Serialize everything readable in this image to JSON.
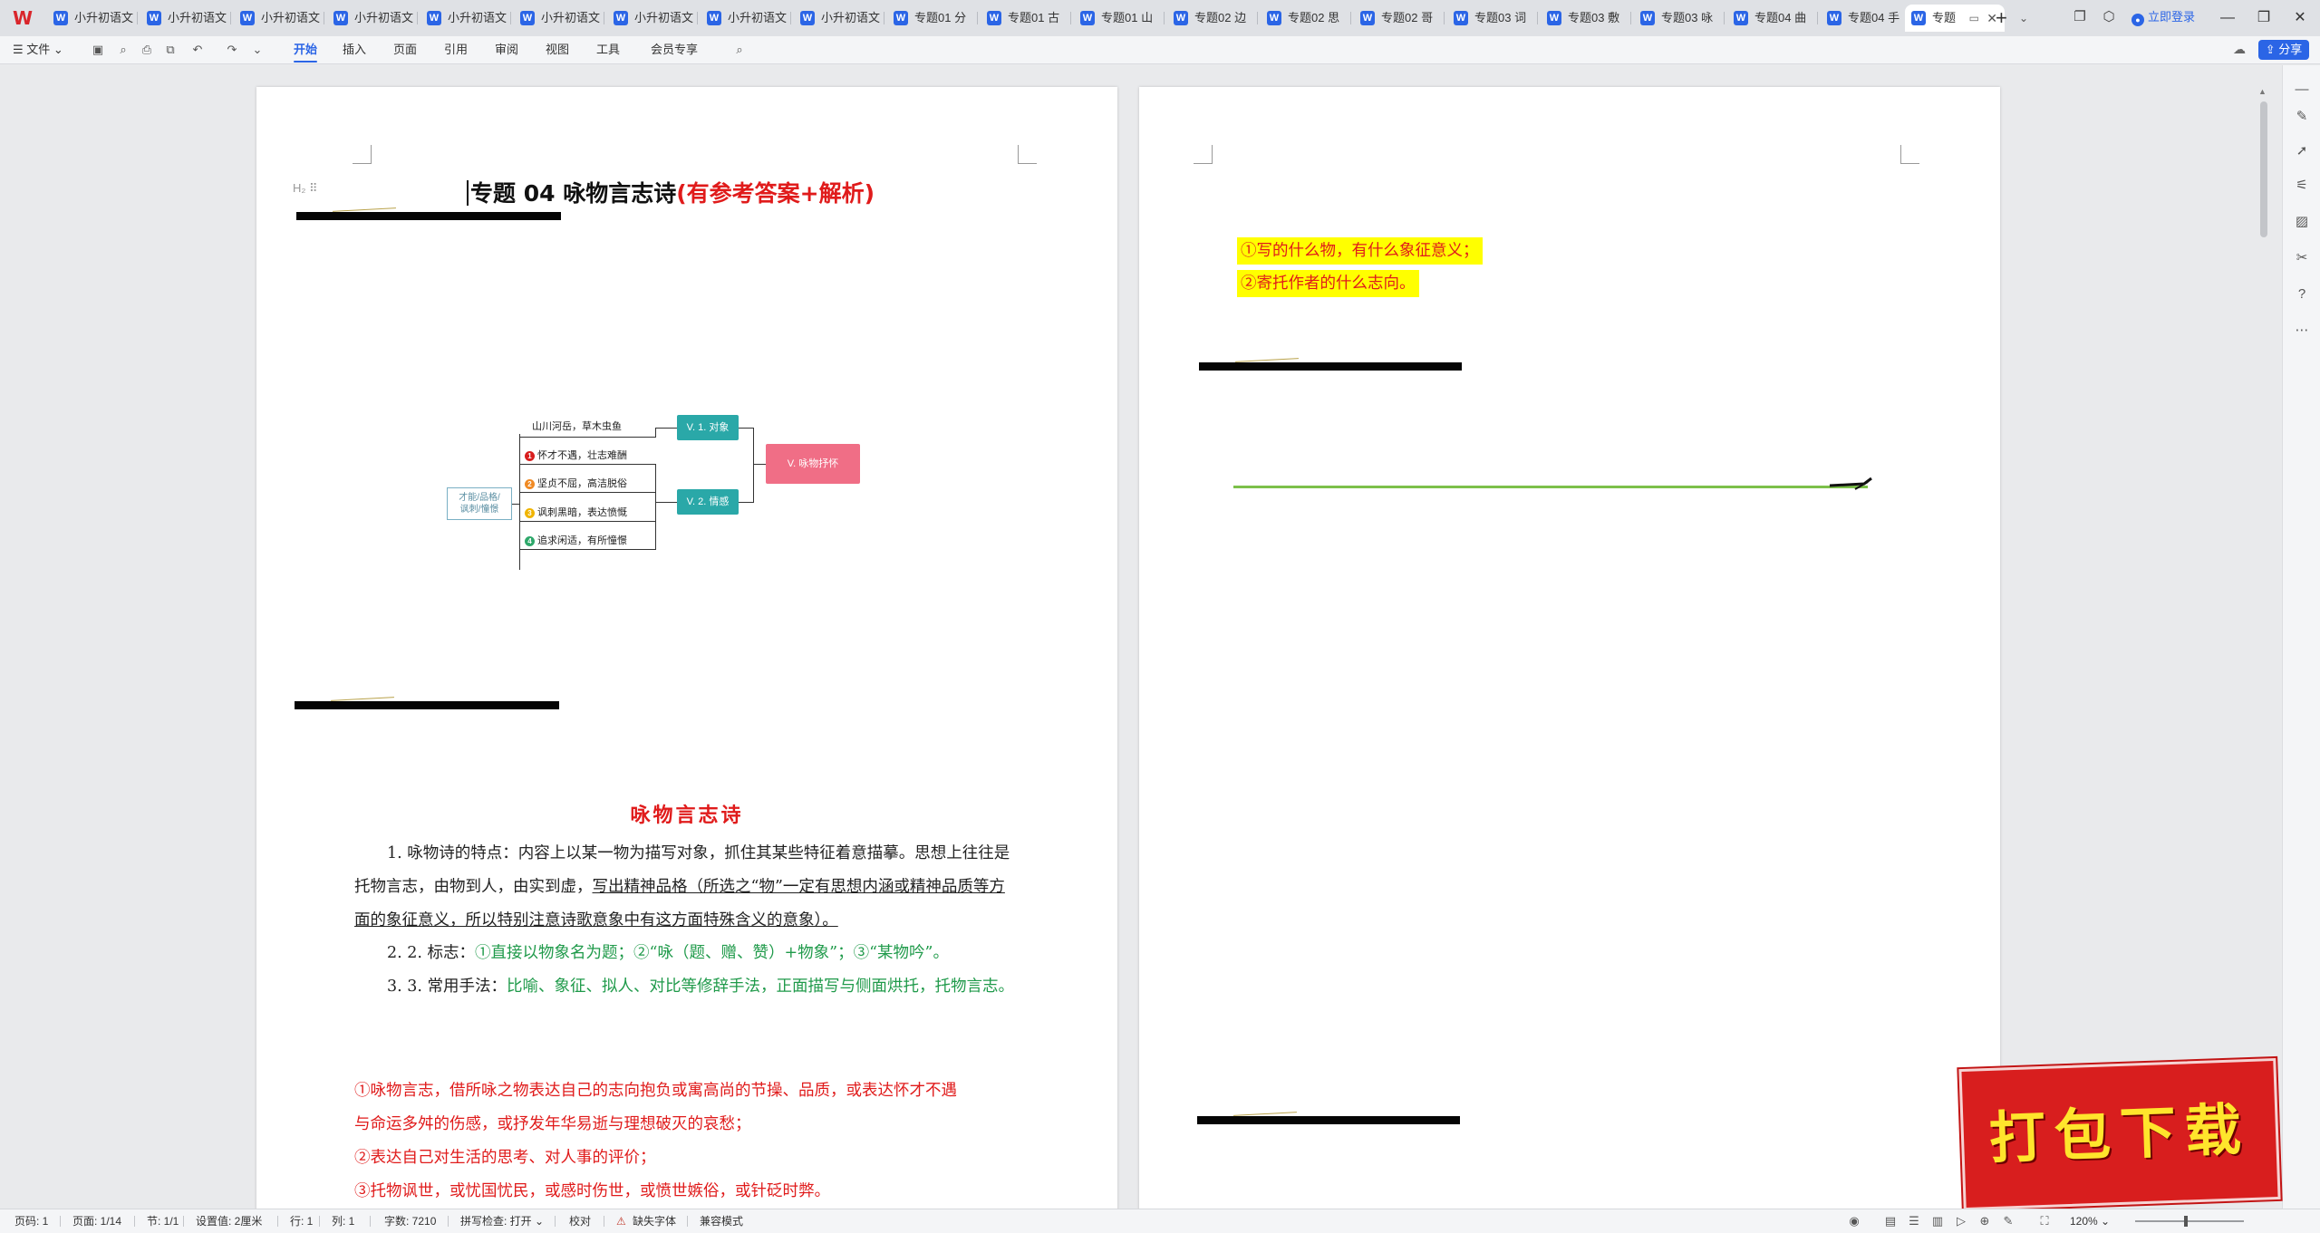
{
  "tabbar": {
    "tabs": [
      {
        "label": "小升初语文"
      },
      {
        "label": "小升初语文"
      },
      {
        "label": "小升初语文"
      },
      {
        "label": "小升初语文"
      },
      {
        "label": "小升初语文"
      },
      {
        "label": "小升初语文"
      },
      {
        "label": "小升初语文"
      },
      {
        "label": "小升初语文"
      },
      {
        "label": "小升初语文"
      },
      {
        "label": "专题01 分"
      },
      {
        "label": "专题01 古"
      },
      {
        "label": "专题01 山"
      },
      {
        "label": "专题02 边"
      },
      {
        "label": "专题02 思"
      },
      {
        "label": "专题02 哥"
      },
      {
        "label": "专题03 词"
      },
      {
        "label": "专题03 敷"
      },
      {
        "label": "专题03 咏"
      },
      {
        "label": "专题04 曲"
      },
      {
        "label": "专题04 手"
      }
    ],
    "active_tab": "专题",
    "login": "立即登录"
  },
  "ribbon": {
    "file": "文件",
    "tabs": [
      "开始",
      "插入",
      "页面",
      "引用",
      "审阅",
      "视图",
      "工具",
      "会员专享"
    ],
    "active": "开始",
    "share": "分享"
  },
  "document": {
    "title_main": "专题 04   咏物言志诗",
    "title_suffix": "(有参考答案+解析)",
    "heading_marker": "H₂ ⠿",
    "mindmap": {
      "root": "才能/品格/\n讽刺/憧憬",
      "center": "V. 咏物抒怀",
      "node_object": "V. 1. 对象",
      "node_emotion": "V. 2. 情感",
      "object_item": "山川河岳，草木虫鱼",
      "emotion_items": [
        {
          "num": "1",
          "text": "怀才不遇，壮志难酬",
          "color": "#d81e1e"
        },
        {
          "num": "2",
          "text": "坚贞不屈，高洁脱俗",
          "color": "#f08a24"
        },
        {
          "num": "3",
          "text": "讽刺黑暗，表达愤慨",
          "color": "#f0b400"
        },
        {
          "num": "4",
          "text": "追求闲适，有所憧憬",
          "color": "#2fa86b"
        }
      ]
    },
    "section_title": "咏物言志诗",
    "p1_a": "1.   咏物诗的特点：内容上以某一物为描写对象，抓住其某些特征着意描摹。思想上往往是托物言志，由物到人，由实到虚，",
    "p1_b": "写出精神品格（所选之“物”一定有思想内涵或精神品质等方面的象征意义，所以特别注意诗歌意象中有这方面特殊含义的意象）。",
    "p2_label": "2.  2.  标志：",
    "p2_text": "①直接以物象名为题；②“咏（题、赠、赞）+物象”；③“某物吟”。",
    "p3_label": "3.  3.  常用手法：",
    "p3_text": "比喻、象征、拟人、对比等修辞手法，正面描写与侧面烘托，托物言志。",
    "red_lines": [
      "①咏物言志，借所咏之物表达自己的志向抱负或寓高尚的节操、品质，或表达怀才不遇",
      "与命运多舛的伤感，或抒发年华易逝与理想破灭的哀愁；",
      "②表达自己对生活的思考、对人事的评价；",
      "③托物讽世，或忧国忧民，或感时伤世，或愤世嫉俗，或针砭时弊。"
    ],
    "page2_lines": [
      "①写的什么物，有什么象征意义；",
      "②寄托作者的什么志向。"
    ]
  },
  "download_badge": "打包下载",
  "status": {
    "page": "页码: 1",
    "pages": "页面: 1/14",
    "section": "节: 1/1",
    "setting": "设置值: 2厘米",
    "row": "行: 1",
    "col": "列: 1",
    "words": "字数: 7210",
    "spell": "拼写检查: 打开",
    "proof": "校对",
    "missing_font": "缺失字体",
    "compat": "兼容模式",
    "zoom": "120%"
  }
}
